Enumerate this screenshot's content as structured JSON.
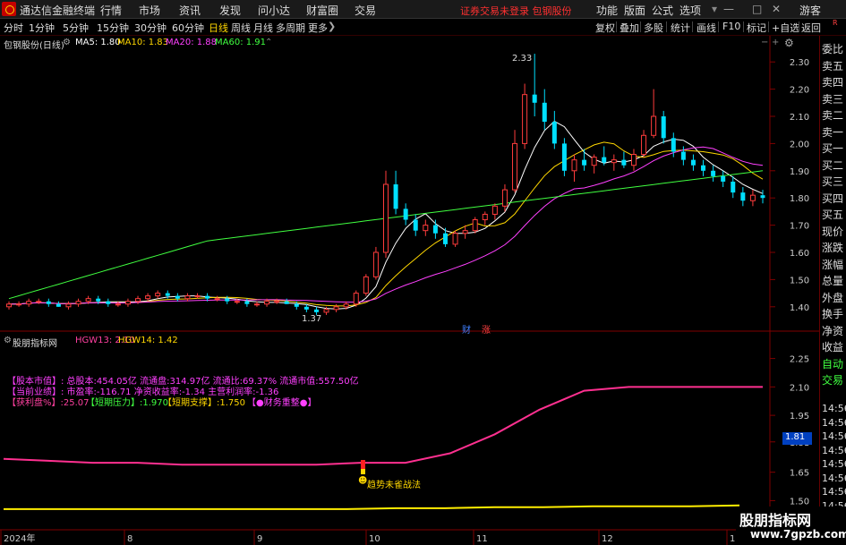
{
  "menubar": {
    "app_title": "通达信金融终端",
    "menus": [
      "行情",
      "市场",
      "资讯",
      "发现",
      "问小达",
      "财富圈",
      "交易"
    ],
    "login_notice": "证券交易未登录 包钢股份",
    "right_menus": [
      "功能",
      "版面",
      "公式",
      "选项"
    ],
    "guest": "游客"
  },
  "periods": [
    "分时",
    "1分钟",
    "5分钟",
    "15分钟",
    "30分钟",
    "60分钟",
    "日线",
    "周线",
    "月线",
    "多周期",
    "更多"
  ],
  "active_period": "日线",
  "toolbar": [
    "复权",
    "叠加",
    "多股",
    "统计",
    "画线",
    "F10",
    "标记",
    "+自选",
    "返回"
  ],
  "main_chart": {
    "stock_title": "包钢股份(日线)",
    "ma_legend": [
      {
        "label": "MA5: 1.80",
        "color": "#ffffff"
      },
      {
        "label": "MA10: 1.83",
        "color": "#ffd700"
      },
      {
        "label": "MA20: 1.88",
        "color": "#ff40ff"
      },
      {
        "label": "MA60: 1.91",
        "color": "#40ff40"
      }
    ],
    "y_ticks": [
      "2.30",
      "2.20",
      "2.10",
      "2.00",
      "1.90",
      "1.80",
      "1.70",
      "1.60",
      "1.50",
      "1.40"
    ],
    "high_label": "2.33",
    "low_label": "1.37",
    "markers": [
      "财",
      "涨"
    ]
  },
  "indicator": {
    "title": "股朋指标网",
    "hgw13": "HGW13: 2.10",
    "hgw14": "HGW14: 1.42",
    "info_line1": "【股本市值】: 总股本:454.05亿 流通盘:314.97亿 流通比:69.37% 流通市值:557.50亿",
    "info_line2": "【当前业绩】: 市盈率:-116.71 净资收益率:-1.34 主营利润率:-1.36",
    "info_line3_a": "【获利盘%】:25.07",
    "info_line3_b": "【短期压力】:1.970",
    "info_line3_c": "【短期支撑】:1.750",
    "info_line3_d": "【●财务重整●】",
    "signal_label": "趋势未雀战法",
    "y_ticks": [
      "2.25",
      "2.10",
      "1.95",
      "1.81",
      "1.65",
      "1.50"
    ],
    "current_value": "1.81"
  },
  "x_axis": [
    "2024年",
    "8",
    "9",
    "10",
    "11",
    "12",
    "1"
  ],
  "right_panel": {
    "top_label": "R",
    "items": [
      "委比",
      "卖五",
      "卖四",
      "卖三",
      "卖二",
      "卖一",
      "买一",
      "买二",
      "买三",
      "买四",
      "买五",
      "现价",
      "涨跌",
      "涨幅",
      "总量",
      "外盘",
      "换手",
      "净资",
      "收益",
      "自动",
      "交易"
    ],
    "times": [
      "14:56",
      "14:56",
      "14:56",
      "14:56",
      "14:56",
      "14:56",
      "14:56",
      "14:56",
      "14:56",
      "14:56"
    ]
  },
  "watermark": {
    "title": "股朋指标网",
    "url": "www.7gpzb.com"
  },
  "chart_data": {
    "type": "candlestick",
    "ylim": [
      1.35,
      2.35
    ],
    "ohlc": [
      [
        1.4,
        1.42,
        1.39,
        1.41
      ],
      [
        1.41,
        1.42,
        1.4,
        1.41
      ],
      [
        1.41,
        1.43,
        1.4,
        1.42
      ],
      [
        1.42,
        1.43,
        1.41,
        1.42
      ],
      [
        1.42,
        1.43,
        1.4,
        1.41
      ],
      [
        1.41,
        1.42,
        1.4,
        1.4
      ],
      [
        1.4,
        1.42,
        1.39,
        1.41
      ],
      [
        1.41,
        1.43,
        1.4,
        1.42
      ],
      [
        1.42,
        1.44,
        1.41,
        1.43
      ],
      [
        1.43,
        1.44,
        1.41,
        1.42
      ],
      [
        1.42,
        1.43,
        1.4,
        1.41
      ],
      [
        1.41,
        1.42,
        1.4,
        1.41
      ],
      [
        1.41,
        1.43,
        1.4,
        1.42
      ],
      [
        1.42,
        1.44,
        1.41,
        1.43
      ],
      [
        1.43,
        1.45,
        1.42,
        1.44
      ],
      [
        1.44,
        1.46,
        1.43,
        1.45
      ],
      [
        1.45,
        1.46,
        1.43,
        1.44
      ],
      [
        1.44,
        1.45,
        1.42,
        1.43
      ],
      [
        1.43,
        1.45,
        1.42,
        1.44
      ],
      [
        1.44,
        1.45,
        1.43,
        1.44
      ],
      [
        1.44,
        1.45,
        1.42,
        1.43
      ],
      [
        1.43,
        1.44,
        1.42,
        1.43
      ],
      [
        1.43,
        1.44,
        1.41,
        1.42
      ],
      [
        1.42,
        1.43,
        1.41,
        1.42
      ],
      [
        1.42,
        1.43,
        1.4,
        1.41
      ],
      [
        1.41,
        1.42,
        1.4,
        1.41
      ],
      [
        1.41,
        1.43,
        1.4,
        1.42
      ],
      [
        1.42,
        1.43,
        1.41,
        1.42
      ],
      [
        1.42,
        1.43,
        1.41,
        1.41
      ],
      [
        1.41,
        1.42,
        1.39,
        1.4
      ],
      [
        1.4,
        1.41,
        1.38,
        1.39
      ],
      [
        1.39,
        1.4,
        1.37,
        1.38
      ],
      [
        1.38,
        1.4,
        1.37,
        1.39
      ],
      [
        1.39,
        1.41,
        1.38,
        1.4
      ],
      [
        1.4,
        1.42,
        1.39,
        1.41
      ],
      [
        1.41,
        1.46,
        1.4,
        1.45
      ],
      [
        1.45,
        1.52,
        1.44,
        1.51
      ],
      [
        1.51,
        1.62,
        1.5,
        1.6
      ],
      [
        1.6,
        1.9,
        1.58,
        1.85
      ],
      [
        1.85,
        1.9,
        1.74,
        1.76
      ],
      [
        1.76,
        1.78,
        1.7,
        1.72
      ],
      [
        1.72,
        1.74,
        1.66,
        1.68
      ],
      [
        1.68,
        1.72,
        1.66,
        1.7
      ],
      [
        1.7,
        1.72,
        1.65,
        1.67
      ],
      [
        1.67,
        1.69,
        1.62,
        1.63
      ],
      [
        1.63,
        1.68,
        1.62,
        1.67
      ],
      [
        1.67,
        1.7,
        1.65,
        1.68
      ],
      [
        1.68,
        1.73,
        1.67,
        1.72
      ],
      [
        1.72,
        1.75,
        1.7,
        1.74
      ],
      [
        1.74,
        1.78,
        1.72,
        1.77
      ],
      [
        1.77,
        1.85,
        1.75,
        1.83
      ],
      [
        1.83,
        2.05,
        1.82,
        2.0
      ],
      [
        2.0,
        2.22,
        1.98,
        2.18
      ],
      [
        2.18,
        2.33,
        2.1,
        2.15
      ],
      [
        2.15,
        2.2,
        2.05,
        2.08
      ],
      [
        2.08,
        2.12,
        1.98,
        2.0
      ],
      [
        2.0,
        2.02,
        1.88,
        1.9
      ],
      [
        1.9,
        1.96,
        1.86,
        1.94
      ],
      [
        1.94,
        1.98,
        1.9,
        1.92
      ],
      [
        1.92,
        1.96,
        1.89,
        1.95
      ],
      [
        1.95,
        1.99,
        1.92,
        1.93
      ],
      [
        1.93,
        1.96,
        1.9,
        1.94
      ],
      [
        1.94,
        1.97,
        1.91,
        1.92
      ],
      [
        1.92,
        1.98,
        1.9,
        1.96
      ],
      [
        1.96,
        2.05,
        1.95,
        2.03
      ],
      [
        2.03,
        2.2,
        2.02,
        2.1
      ],
      [
        2.1,
        2.12,
        2.0,
        2.02
      ],
      [
        2.02,
        2.04,
        1.95,
        1.97
      ],
      [
        1.97,
        1.99,
        1.92,
        1.94
      ],
      [
        1.94,
        1.96,
        1.9,
        1.92
      ],
      [
        1.92,
        1.94,
        1.88,
        1.9
      ],
      [
        1.9,
        1.92,
        1.86,
        1.88
      ],
      [
        1.88,
        1.9,
        1.84,
        1.86
      ],
      [
        1.86,
        1.88,
        1.8,
        1.82
      ],
      [
        1.82,
        1.84,
        1.77,
        1.79
      ],
      [
        1.79,
        1.83,
        1.77,
        1.81
      ],
      [
        1.81,
        1.83,
        1.78,
        1.8
      ]
    ],
    "indicator_line": [
      1.72,
      1.71,
      1.7,
      1.7,
      1.69,
      1.69,
      1.69,
      1.69,
      1.7,
      1.7,
      1.75,
      1.85,
      1.98,
      2.08,
      2.1,
      2.1,
      2.1,
      2.1
    ],
    "base_line": [
      1.455,
      1.455,
      1.455,
      1.455,
      1.455,
      1.455,
      1.455,
      1.455,
      1.46,
      1.46,
      1.465,
      1.465,
      1.47,
      1.47,
      1.47,
      1.475
    ]
  }
}
